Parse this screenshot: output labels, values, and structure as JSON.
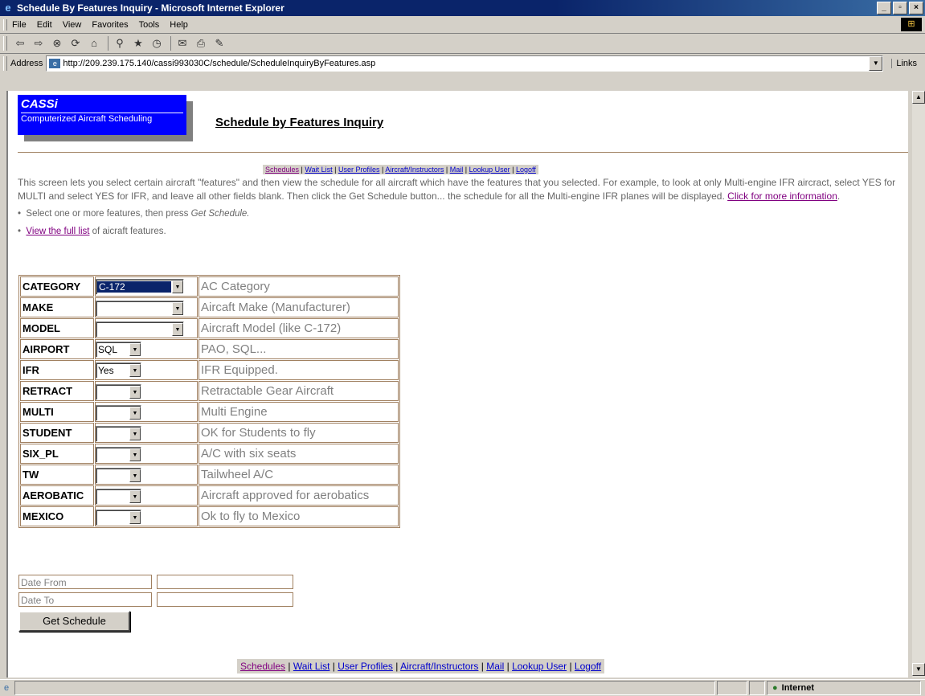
{
  "window": {
    "title": "Schedule By Features Inquiry - Microsoft Internet Explorer"
  },
  "menu": [
    "File",
    "Edit",
    "View",
    "Favorites",
    "Tools",
    "Help"
  ],
  "address": {
    "label": "Address",
    "url": "http://209.239.175.140/cassi993030C/schedule/ScheduleInquiryByFeatures.asp",
    "links": "Links"
  },
  "header": {
    "brand": "CASSi",
    "tagline": "Computerized Aircraft Scheduling",
    "page_title": "Schedule by Features Inquiry"
  },
  "nav": {
    "links": [
      "Schedules",
      "Wait List",
      "User Profiles",
      "Aircraft/Instructors",
      "Mail",
      "Lookup User",
      "Logoff"
    ],
    "separator": "|"
  },
  "intro": {
    "text": "This screen lets you select certain aircraft \"features\" and then view the schedule for all aircraft which have the features that you selected.  For example, to look at only Multi-engine IFR aircract, select YES for MULTI and select YES for IFR, and leave all other fields blank. Then click the Get Schedule button... the schedule for all the Multi-engine IFR planes will be displayed.",
    "more_link": "Click for more information",
    "bullet1_text": "Select one or more features, then press ",
    "bullet1_em": "Get Schedule.",
    "bullet2_link": "View the full list",
    "bullet2_text": " of aicraft features."
  },
  "features": [
    {
      "label": "CATEGORY",
      "value": "C-172",
      "desc": "AC Category"
    },
    {
      "label": "MAKE",
      "value": "",
      "desc": "Aircaft Make (Manufacturer)"
    },
    {
      "label": "MODEL",
      "value": "",
      "desc": "Aircraft Model (like C-172)"
    },
    {
      "label": "AIRPORT",
      "value": "SQL",
      "desc": "PAO, SQL..."
    },
    {
      "label": "IFR",
      "value": "Yes",
      "desc": "IFR Equipped."
    },
    {
      "label": "RETRACT",
      "value": "",
      "desc": "Retractable Gear Aircraft"
    },
    {
      "label": "MULTI",
      "value": "",
      "desc": "Multi Engine"
    },
    {
      "label": "STUDENT",
      "value": "",
      "desc": "OK for Students to fly"
    },
    {
      "label": "SIX_PL",
      "value": "",
      "desc": "A/C with six seats"
    },
    {
      "label": "TW",
      "value": "",
      "desc": "Tailwheel A/C"
    },
    {
      "label": "AEROBATIC",
      "value": "",
      "desc": "Aircraft approved for aerobatics"
    },
    {
      "label": "MEXICO",
      "value": "",
      "desc": "Ok to fly to Mexico"
    }
  ],
  "dates": {
    "from_label": "Date From",
    "to_label": "Date To",
    "from_value": "",
    "to_value": ""
  },
  "button": {
    "get_schedule": "Get Schedule"
  },
  "status": {
    "zone": "Internet"
  }
}
